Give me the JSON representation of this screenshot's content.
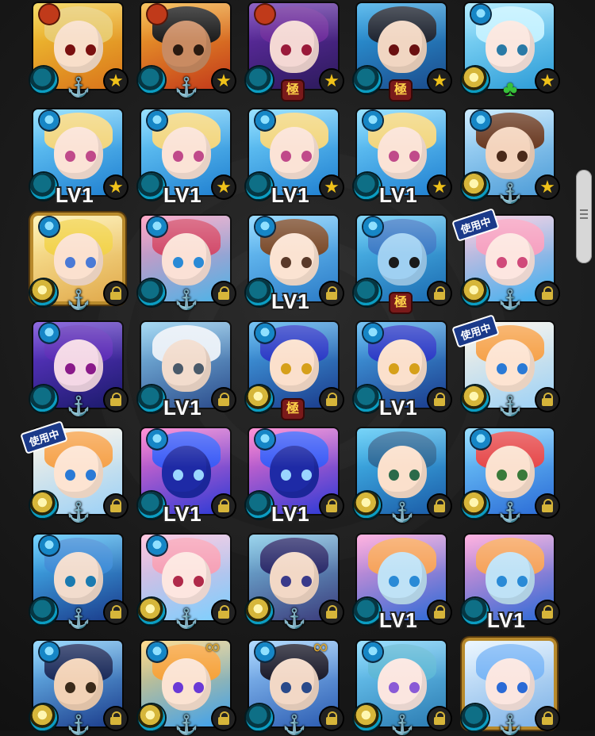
{
  "labels": {
    "level": "LV1",
    "in_use": "使用中",
    "kiwami": "極"
  },
  "cards": [
    {
      "bg": [
        "#f3d037",
        "#d9731a"
      ],
      "hair": "#e8c96a",
      "face": "#f8dfca",
      "eye": "#7a1010",
      "el": "blue",
      "overlay": "anchor",
      "badge": "star",
      "top": "red"
    },
    {
      "bg": [
        "#f4b22e",
        "#c2381a"
      ],
      "hair": "#1b1b1b",
      "face": "#c98b62",
      "eye": "#2a1a10",
      "el": "blue",
      "overlay": "anchor",
      "badge": "star",
      "top": "red"
    },
    {
      "bg": [
        "#6a2fb0",
        "#2b1a5a"
      ],
      "hair": "#6b2a9a",
      "face": "#f4d8d4",
      "eye": "#9a1a3a",
      "el": "blue",
      "overlay": "kiwami",
      "badge": "star",
      "top": "red"
    },
    {
      "bg": [
        "#2fa7e8",
        "#1b4a8a"
      ],
      "hair": "#1e2430",
      "face": "#f1d6c2",
      "eye": "#6a1010",
      "el": "blue",
      "overlay": "kiwami",
      "badge": "star",
      "top": ""
    },
    {
      "bg": [
        "#9be6ff",
        "#2a9ad6"
      ],
      "hair": "#bff0ff",
      "face": "#fbe7df",
      "eye": "#2a7aa6",
      "el": "gold",
      "overlay": "clover",
      "badge": "star",
      "top": "blue"
    },
    {
      "bg": [
        "#78d8ff",
        "#1f7fd0"
      ],
      "hair": "#f2d67e",
      "face": "#fbe3d6",
      "eye": "#c04a8a",
      "el": "blue",
      "overlay": "lv",
      "badge": "star",
      "top": "blue"
    },
    {
      "bg": [
        "#78d8ff",
        "#1f7fd0"
      ],
      "hair": "#f2d67e",
      "face": "#fbe3d6",
      "eye": "#c04a8a",
      "el": "blue",
      "overlay": "lv",
      "badge": "star",
      "top": "blue"
    },
    {
      "bg": [
        "#78d8ff",
        "#1f7fd0"
      ],
      "hair": "#f2d67e",
      "face": "#fbe3d6",
      "eye": "#c04a8a",
      "el": "blue",
      "overlay": "lv",
      "badge": "star",
      "top": "blue"
    },
    {
      "bg": [
        "#78d8ff",
        "#1f7fd0"
      ],
      "hair": "#f2d67e",
      "face": "#fbe3d6",
      "eye": "#c04a8a",
      "el": "blue",
      "overlay": "lv",
      "badge": "star",
      "top": "blue"
    },
    {
      "bg": [
        "#bde6ff",
        "#4a9ad6"
      ],
      "hair": "#6a3a22",
      "face": "#f4d4bd",
      "eye": "#4a2a1a",
      "el": "gold",
      "overlay": "anchor",
      "badge": "star",
      "top": "blue"
    },
    {
      "bg": [
        "#fff1a6",
        "#e0a84a"
      ],
      "hair": "#f2d24a",
      "face": "#fbe1cf",
      "eye": "#4a7ad6",
      "el": "gold",
      "overlay": "anchor",
      "badge": "lock",
      "top": "blue",
      "frame": true
    },
    {
      "bg": [
        "#ff8fb6",
        "#4ab4e8"
      ],
      "hair": "#d24a6a",
      "face": "#fbe1d6",
      "eye": "#2a8ad6",
      "el": "blue",
      "overlay": "anchor",
      "badge": "lock",
      "top": "blue"
    },
    {
      "bg": [
        "#7ad0ff",
        "#2a7ac6"
      ],
      "hair": "#7a4a2a",
      "face": "#fbe3d2",
      "eye": "#5a3a2a",
      "el": "blue",
      "overlay": "lv",
      "badge": "lock",
      "top": "blue"
    },
    {
      "bg": [
        "#5ac8f6",
        "#1a6ab0"
      ],
      "hair": "#3a7ac6",
      "face": "#9fd0f2",
      "eye": "#1a1a1a",
      "el": "blue",
      "overlay": "kiwami",
      "badge": "lock",
      "top": "blue"
    },
    {
      "bg": [
        "#ffc1d8",
        "#3ab0f0"
      ],
      "hair": "#f6a0c0",
      "face": "#fde6e0",
      "eye": "#d04a7a",
      "el": "gold",
      "overlay": "anchor",
      "badge": "lock",
      "top": "",
      "inuse": true
    },
    {
      "bg": [
        "#6a3ad6",
        "#1a1a6a"
      ],
      "hair": "#5a2ab6",
      "face": "#f4d8e6",
      "eye": "#8a1a8a",
      "el": "blue",
      "overlay": "anchor",
      "badge": "lock",
      "top": "blue"
    },
    {
      "bg": [
        "#8acdf0",
        "#2a4a8a"
      ],
      "hair": "#e6eef6",
      "face": "#f2dccd",
      "eye": "#4a5a6a",
      "el": "blue",
      "overlay": "lv",
      "badge": "lock",
      "top": ""
    },
    {
      "bg": [
        "#4ab0f0",
        "#1a3a8a"
      ],
      "hair": "#2a3ac6",
      "face": "#fbe0cc",
      "eye": "#d6a01a",
      "el": "gold",
      "overlay": "kiwami",
      "badge": "lock",
      "top": "blue"
    },
    {
      "bg": [
        "#4ab0f0",
        "#1a3a8a"
      ],
      "hair": "#2a3ac6",
      "face": "#fbe0cc",
      "eye": "#d6a01a",
      "el": "blue",
      "overlay": "lv",
      "badge": "lock",
      "top": "blue"
    },
    {
      "bg": [
        "#fff4e4",
        "#9ad0f6"
      ],
      "hair": "#f6a24a",
      "face": "#fde4d2",
      "eye": "#2a7ad6",
      "el": "gold",
      "overlay": "anchor",
      "badge": "lock",
      "top": "",
      "inuse": true
    },
    {
      "bg": [
        "#fff4e4",
        "#9ad0f6"
      ],
      "hair": "#f6a24a",
      "face": "#fde4d2",
      "eye": "#2a7ad6",
      "el": "gold",
      "overlay": "anchor",
      "badge": "lock",
      "top": "",
      "inuse": true
    },
    {
      "bg": [
        "#ff70c8",
        "#2a3ad6"
      ],
      "hair": "#3a5af6",
      "face": "#1e2aa6",
      "eye": "#9ad6ff",
      "el": "blue",
      "overlay": "lv",
      "badge": "lock",
      "top": "blue"
    },
    {
      "bg": [
        "#ff70c8",
        "#2a3ad6"
      ],
      "hair": "#3a5af6",
      "face": "#1e2aa6",
      "eye": "#9ad6ff",
      "el": "blue",
      "overlay": "lv",
      "badge": "lock",
      "top": "blue"
    },
    {
      "bg": [
        "#4ac6f6",
        "#1a5aa6"
      ],
      "hair": "#2a6a9a",
      "face": "#fbe0cc",
      "eye": "#2a6a4a",
      "el": "gold",
      "overlay": "anchor",
      "badge": "lock",
      "top": ""
    },
    {
      "bg": [
        "#7ad6ff",
        "#2a6ad6"
      ],
      "hair": "#e6484a",
      "face": "#fbe1cf",
      "eye": "#3a7a3a",
      "el": "gold",
      "overlay": "anchor",
      "badge": "lock",
      "top": "blue"
    },
    {
      "bg": [
        "#4ac6ff",
        "#1a3a8a"
      ],
      "hair": "#3a8ad6",
      "face": "#f2dccd",
      "eye": "#1a7ab0",
      "el": "blue",
      "overlay": "anchor",
      "badge": "lock",
      "top": "blue"
    },
    {
      "bg": [
        "#ffb6d6",
        "#7ad0ff"
      ],
      "hair": "#f6a0b6",
      "face": "#fde6e0",
      "eye": "#b02a4a",
      "el": "gold",
      "overlay": "anchor",
      "badge": "lock",
      "top": "blue"
    },
    {
      "bg": [
        "#7ac6e6",
        "#3a3a7a"
      ],
      "hair": "#2a2a6a",
      "face": "#f2d8c6",
      "eye": "#3a3a8a",
      "el": "gold",
      "overlay": "anchor",
      "badge": "lock",
      "top": ""
    },
    {
      "bg": [
        "#ff9ad6",
        "#2a6ad6"
      ],
      "hair": "#f6a25a",
      "face": "#bfe2f6",
      "eye": "#2a8ad6",
      "el": "blue",
      "overlay": "lv",
      "badge": "lock",
      "top": ""
    },
    {
      "bg": [
        "#ff9ad6",
        "#2a6ad6"
      ],
      "hair": "#f6a25a",
      "face": "#bfe2f6",
      "eye": "#2a8ad6",
      "el": "blue",
      "overlay": "lv",
      "badge": "lock",
      "top": ""
    },
    {
      "bg": [
        "#7ad0ff",
        "#1a3a8a"
      ],
      "hair": "#1a2a5a",
      "face": "#f2d2b6",
      "eye": "#3a2a1a",
      "el": "gold",
      "overlay": "anchor",
      "badge": "lock",
      "top": "blue"
    },
    {
      "bg": [
        "#ffcf6a",
        "#3aa0f0"
      ],
      "hair": "#f6a23a",
      "face": "#fbe3d2",
      "eye": "#6a3ad6",
      "el": "gold",
      "overlay": "anchor",
      "badge": "lock",
      "top": "blue",
      "chain": true
    },
    {
      "bg": [
        "#9ad0ff",
        "#2a5ab0"
      ],
      "hair": "#1a1a2a",
      "face": "#f2d8c6",
      "eye": "#2a4a8a",
      "el": "blue",
      "overlay": "anchor",
      "badge": "lock",
      "top": "blue",
      "chain": true
    },
    {
      "bg": [
        "#7ad6ff",
        "#2a7ab0"
      ],
      "hair": "#5ab6d6",
      "face": "#fbe6e0",
      "eye": "#8a5ad6",
      "el": "gold",
      "overlay": "anchor",
      "badge": "lock",
      "top": "blue"
    },
    {
      "bg": [
        "#e6f4ff",
        "#7ab0e6"
      ],
      "hair": "#7ab6f6",
      "face": "#fbe6e0",
      "eye": "#2a6ad6",
      "el": "blue",
      "overlay": "anchor",
      "badge": "lock",
      "top": "",
      "frame": true
    }
  ]
}
